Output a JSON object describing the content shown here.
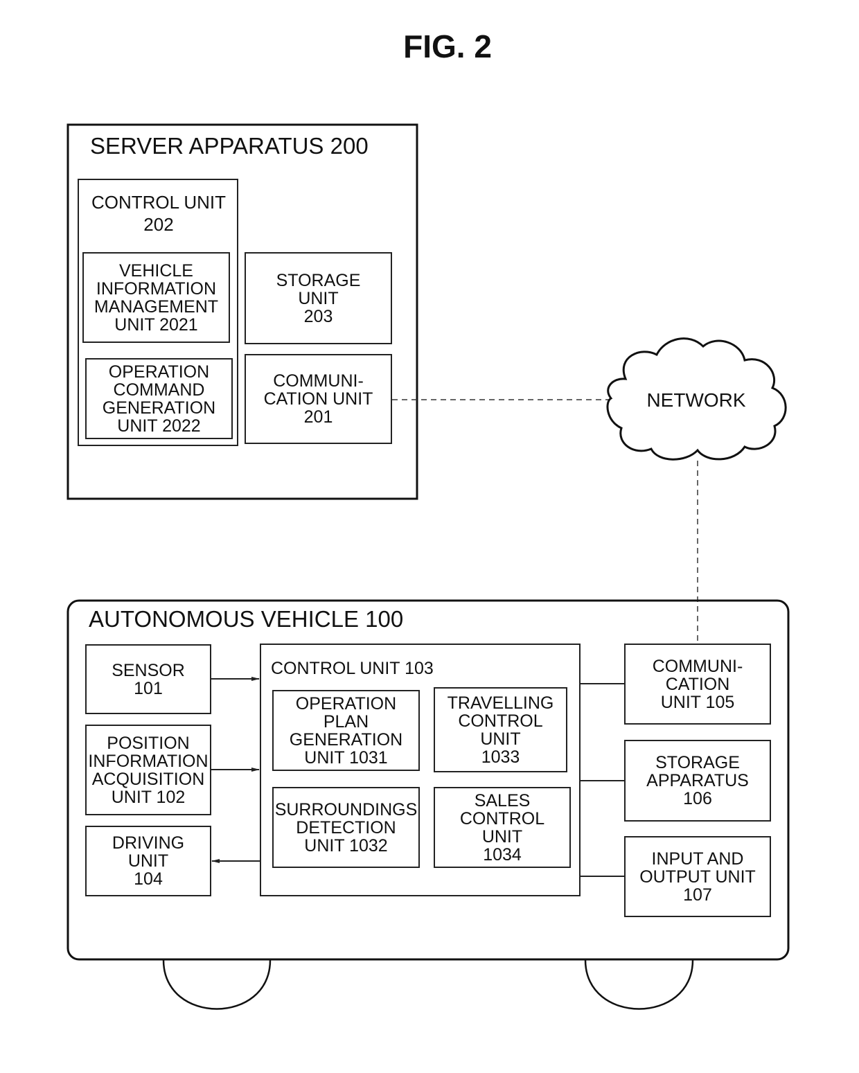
{
  "figure": {
    "title": "FIG. 2"
  },
  "server": {
    "title": "SERVER APPARATUS  200",
    "control_unit": {
      "line1": "CONTROL UNIT",
      "line2": "202"
    },
    "vehicle_info_mgmt": [
      "VEHICLE",
      "INFORMATION",
      "MANAGEMENT",
      "UNIT  2021"
    ],
    "operation_command_gen": [
      "OPERATION",
      "COMMAND",
      "GENERATION",
      "UNIT  2022"
    ],
    "storage_unit": [
      "STORAGE",
      "UNIT",
      "203"
    ],
    "communication_unit": [
      "COMMUNI-",
      "CATION UNIT",
      "201"
    ]
  },
  "network": {
    "label": "NETWORK"
  },
  "vehicle": {
    "title": "AUTONOMOUS VEHICLE  100",
    "sensor": [
      "SENSOR",
      "101"
    ],
    "position_info": [
      "POSITION",
      "INFORMATION",
      "ACQUISITION",
      "UNIT  102"
    ],
    "driving_unit": [
      "DRIVING",
      "UNIT",
      "104"
    ],
    "control_unit": {
      "title": "CONTROL UNIT  103"
    },
    "operation_plan_gen": [
      "OPERATION",
      "PLAN",
      "GENERATION",
      "UNIT  1031"
    ],
    "travelling_control": [
      "TRAVELLING",
      "CONTROL",
      "UNIT",
      "1033"
    ],
    "surroundings_detection": [
      "SURROUNDINGS",
      "DETECTION",
      "UNIT  1032"
    ],
    "sales_control": [
      "SALES",
      "CONTROL",
      "UNIT",
      "1034"
    ],
    "communication_unit": [
      "COMMUNI-",
      "CATION",
      "UNIT  105"
    ],
    "storage_apparatus": [
      "STORAGE",
      "APPARATUS",
      "106"
    ],
    "io_unit": [
      "INPUT AND",
      "OUTPUT UNIT",
      "107"
    ]
  }
}
